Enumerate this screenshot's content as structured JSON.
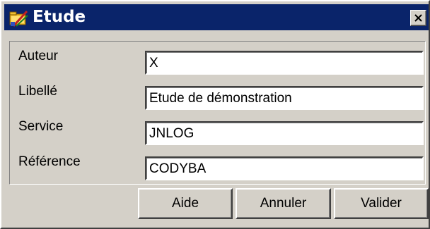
{
  "window": {
    "title": "Etude"
  },
  "form": {
    "fields": [
      {
        "label": "Auteur",
        "value": "X"
      },
      {
        "label": "Libellé",
        "value": "Etude de démonstration"
      },
      {
        "label": "Service",
        "value": "JNLOG"
      },
      {
        "label": "Référence",
        "value": "CODYBA"
      }
    ]
  },
  "buttons": {
    "help": "Aide",
    "cancel": "Annuler",
    "validate": "Valider"
  },
  "icons": {
    "app": "folder-pencil-icon",
    "close": "close-icon"
  },
  "colors": {
    "titlebar": "#0a246a",
    "face": "#d4d0c8"
  }
}
